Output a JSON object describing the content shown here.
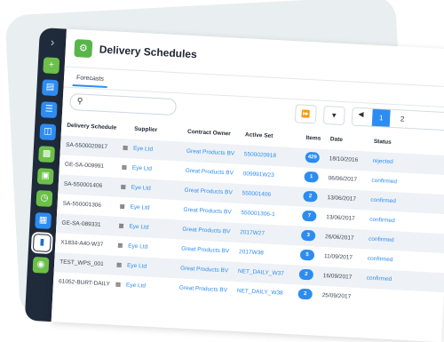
{
  "app": {
    "title": "Delivery Schedules",
    "icon": "delivery-schedules-icon",
    "accent": "#2d8cf0"
  },
  "tabs": [
    {
      "label": "Forecasts"
    }
  ],
  "search": {
    "placeholder": ""
  },
  "toolbar": {
    "fast_forward_icon": "fast-forward-icon",
    "filter_icon": "filter-icon",
    "pager": {
      "prev_icon": "chevron-left-icon",
      "current": "1",
      "next": "2"
    }
  },
  "table": {
    "headers": {
      "schedule": "Delivery Schedule",
      "supplier": "Supplier",
      "owner": "Contract Owner",
      "set": "Active Set",
      "items": "Items",
      "date": "Date",
      "status": "Status"
    },
    "rows": [
      {
        "schedule": "SA-5500020917",
        "supplier": "Eye Ltd",
        "owner": "Great Products BV",
        "set": "5500020918",
        "items": "429",
        "date": "18/10/2016",
        "status": "rejected"
      },
      {
        "schedule": "GE-SA-009991",
        "supplier": "Eye Ltd",
        "owner": "Great Products BV",
        "set": "009991W23",
        "items": "1",
        "date": "06/06/2017",
        "status": "confirmed"
      },
      {
        "schedule": "SA-550001406",
        "supplier": "Eye Ltd",
        "owner": "Great Products BV",
        "set": "550001406",
        "items": "2",
        "date": "13/06/2017",
        "status": "confirmed"
      },
      {
        "schedule": "SA-550001306",
        "supplier": "Eye Ltd",
        "owner": "Great Products BV",
        "set": "550001306-1",
        "items": "7",
        "date": "13/06/2017",
        "status": "confirmed"
      },
      {
        "schedule": "GE-SA-089331",
        "supplier": "Eye Ltd",
        "owner": "Great Products BV",
        "set": "2017W27",
        "items": "3",
        "date": "26/06/2017",
        "status": "confirmed"
      },
      {
        "schedule": "X1834-A40-W37",
        "supplier": "Eye Ltd",
        "owner": "Great Products BV",
        "set": "2017W38",
        "items": "5",
        "date": "11/09/2017",
        "status": "confirmed"
      },
      {
        "schedule": "TEST_WPS_001",
        "supplier": "Eye Ltd",
        "owner": "Great Products BV",
        "set": "NET_DAILY_W37",
        "items": "2",
        "date": "16/09/2017",
        "status": "confirmed"
      },
      {
        "schedule": "61052-BURT-DAILY",
        "supplier": "Eye Ltd",
        "owner": "Great Products BV",
        "set": "NET_DAILY_W38",
        "items": "2",
        "date": "25/09/2017",
        "status": ""
      }
    ]
  },
  "sidebar": {
    "collapse_icon": "chevron-right-icon",
    "items": [
      {
        "icon": "add-icon",
        "color": "#6cc04a"
      },
      {
        "icon": "inbox-icon",
        "color": "#2d8cf0"
      },
      {
        "icon": "clipboard-icon",
        "color": "#2d8cf0"
      },
      {
        "icon": "cart-icon",
        "color": "#2d8cf0"
      },
      {
        "icon": "delivery-icon",
        "color": "#6cc04a"
      },
      {
        "icon": "warehouse-icon",
        "color": "#6cc04a"
      },
      {
        "icon": "clock-icon",
        "color": "#6cc04a"
      },
      {
        "icon": "building-icon",
        "color": "#2d8cf0"
      },
      {
        "icon": "document-icon",
        "color": "#ffffff"
      },
      {
        "icon": "globe-icon",
        "color": "#6cc04a"
      }
    ]
  }
}
